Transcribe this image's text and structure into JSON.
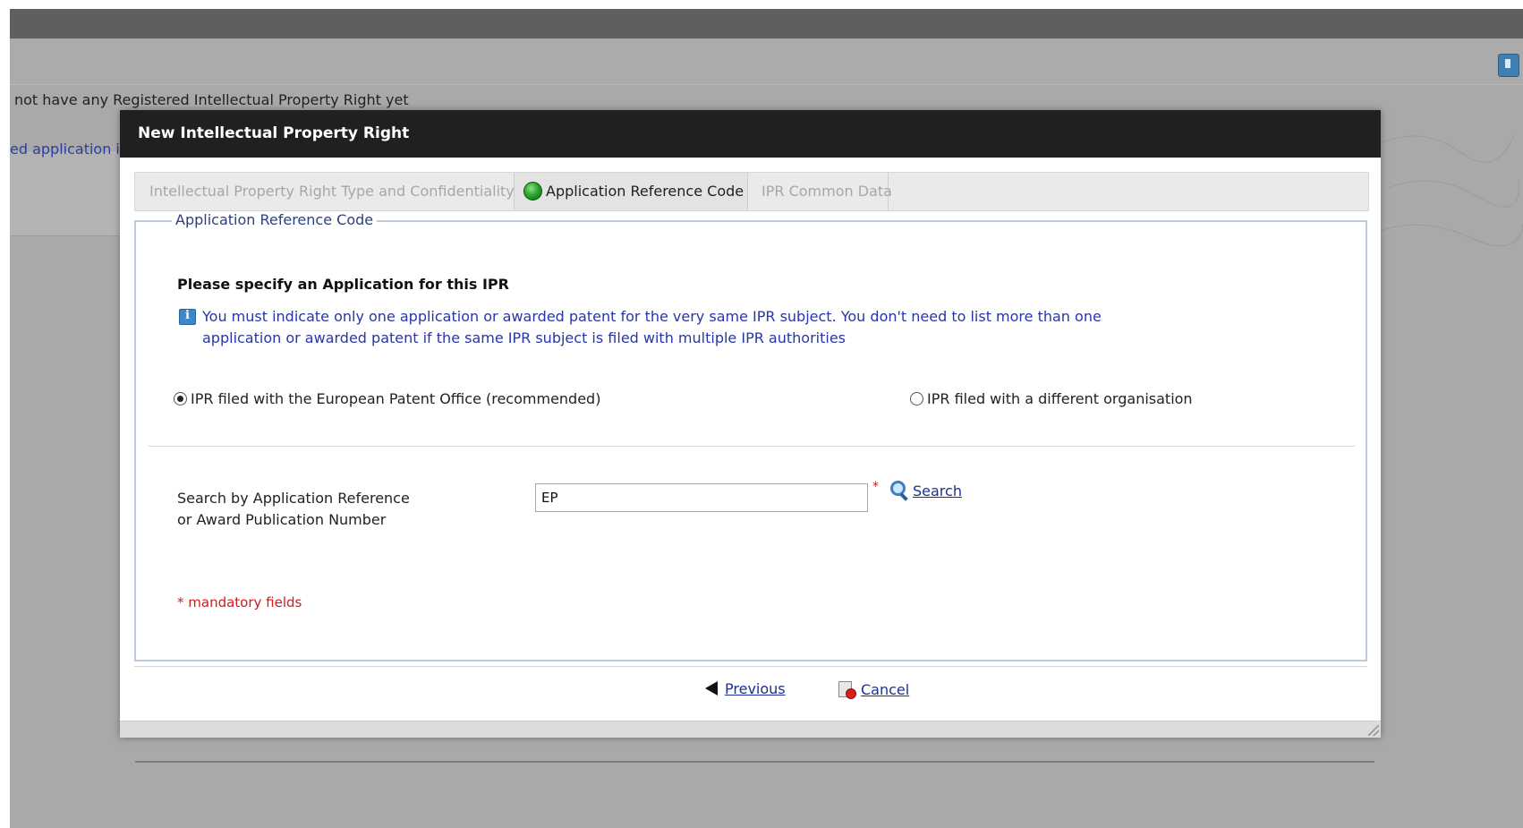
{
  "background": {
    "notice_text": "not have any Registered Intellectual Property Right yet",
    "partial_link_text": "ed application i"
  },
  "modal": {
    "title": "New Intellectual Property Right",
    "tabs": [
      {
        "label": "Intellectual Property Right Type and Confidentiality",
        "state": "inactive"
      },
      {
        "label": "Application Reference Code",
        "state": "active",
        "status_icon": "green-status-icon"
      },
      {
        "label": "IPR Common Data",
        "state": "inactive"
      }
    ],
    "fieldset_legend": "Application Reference Code",
    "prompt": "Please specify an Application for this IPR",
    "info": {
      "icon": "info-icon",
      "text": "You must indicate only one application or awarded patent for the very same IPR subject. You don't need to list more than one application or awarded patent if the same IPR subject is filed with multiple IPR authorities"
    },
    "radio_options": [
      {
        "label": "IPR filed with the European Patent Office (recommended)",
        "checked": true
      },
      {
        "label": "IPR filed with a different organisation",
        "checked": false
      }
    ],
    "search": {
      "label_line1": "Search by Application Reference",
      "label_line2": "or Award Publication Number",
      "value": "EP",
      "required_marker": "*",
      "button_label": "Search"
    },
    "mandatory_note": "* mandatory fields",
    "footer": {
      "previous_label": "Previous",
      "cancel_label": "Cancel"
    }
  },
  "colors": {
    "header_bg": "#202020",
    "link": "#1b2f9a",
    "info_text": "#2836a8",
    "required": "#d41a1a",
    "fieldset_border": "#bccbda"
  }
}
